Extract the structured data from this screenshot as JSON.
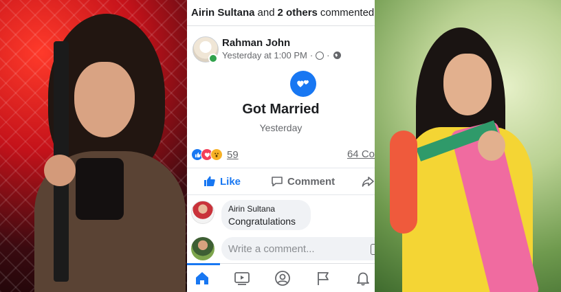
{
  "notification": {
    "actor": "Airin Sultana",
    "connector": "and",
    "others": "2 others",
    "verb": "commented"
  },
  "post": {
    "author": "Rahman John",
    "time": "Yesterday at 1:00 PM",
    "clock_icon": "clock-icon",
    "privacy_icon": "globe-icon"
  },
  "life_event": {
    "icon": "hearts-icon",
    "title": "Got Married",
    "date": "Yesterday"
  },
  "engagement": {
    "reaction_count": "59",
    "comment_count": "64 Co",
    "reactions": [
      "like",
      "love",
      "wow"
    ]
  },
  "actions": {
    "like": "Like",
    "comment": "Comment"
  },
  "comment": {
    "author": "Airin Sultana",
    "text": "Congratulations"
  },
  "composer": {
    "placeholder": "Write a comment..."
  },
  "tabs": [
    "home-icon",
    "video-icon",
    "profile-icon",
    "flag-icon",
    "bell-icon"
  ],
  "colors": {
    "brand_blue": "#1877F2",
    "online_green": "#31A24C",
    "text_secondary": "#65676B"
  }
}
